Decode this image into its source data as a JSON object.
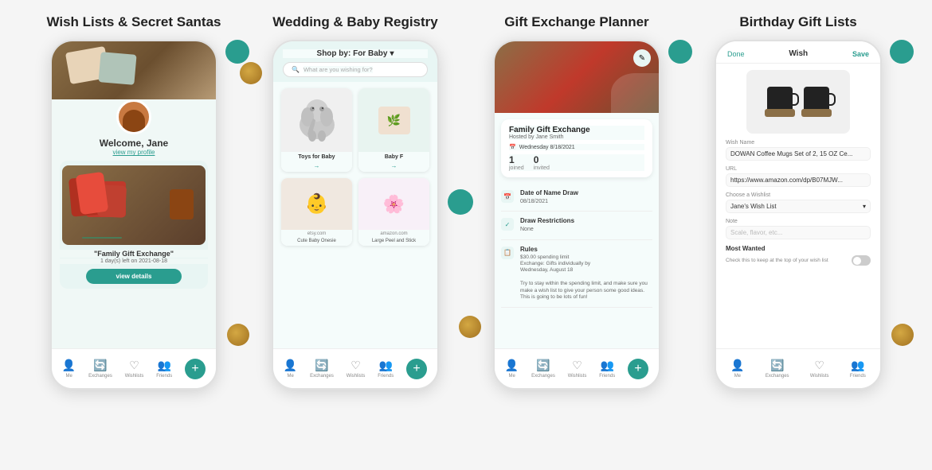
{
  "columns": [
    {
      "id": "wish-lists",
      "title": "Wish Lists & Secret Santas",
      "phone": {
        "welcome": "Welcome, Jane",
        "profile_link": "view my profile",
        "event_name": "\"Family Gift Exchange\"",
        "event_sub": "1 day(s) left on 2021-08-18",
        "view_btn": "view details",
        "nav_items": [
          "Me",
          "Exchanges",
          "Wishlists",
          "Friends"
        ]
      }
    },
    {
      "id": "wedding-registry",
      "title": "Wedding & Baby Registry",
      "phone": {
        "shop_by": "Shop by: For Baby",
        "search_placeholder": "What are you wishing for?",
        "product1_label": "Toys for Baby",
        "product2_label": "Baby F",
        "source1": "etsy.com",
        "source2": "amazon.com",
        "product1_desc": "Cute Baby Onesie",
        "product2_desc": "Large Peel and Stick",
        "nav_items": [
          "Me",
          "Exchanges",
          "Wishlists",
          "Friends"
        ]
      }
    },
    {
      "id": "gift-exchange",
      "title": "Gift Exchange Planner",
      "phone": {
        "event_title": "Family Gift Exchange",
        "host": "Hosted by Jane Smith",
        "date": "Wednesday 8/18/2021",
        "joined": "1",
        "invited": "0",
        "joined_label": "joined",
        "invited_label": "invited",
        "detail1_title": "Date of Name Draw",
        "detail1_val": "08/18/2021",
        "detail2_title": "Draw Restrictions",
        "detail2_val": "None",
        "detail3_title": "Rules",
        "detail3_val": "$30.00 spending limit\nExchange: Gifts individually by\nWednesday, August 18\n\nTry to stay within the spending limit, and make sure you make a wish list to give your person some good ideas. This is going to be lots of fun!",
        "nav_items": [
          "Me",
          "Exchanges",
          "Wishlists",
          "Friends"
        ]
      }
    },
    {
      "id": "birthday",
      "title": "Birthday Gift Lists",
      "phone": {
        "top_done": "Done",
        "top_wish": "Wish",
        "top_save": "Save",
        "wish_name_label": "Wish Name",
        "wish_name_val": "DOWAN Coffee Mugs Set of 2, 15 OZ Ce...",
        "url_label": "URL",
        "url_val": "https://www.amazon.com/dp/B07MJW...",
        "wishlist_label": "Choose a Wishlist",
        "wishlist_val": "Jane's Wish List",
        "note_label": "Note",
        "note_placeholder": "Scale, flavor, etc...",
        "most_wanted_title": "Most Wanted",
        "most_wanted_sub": "Check this to keep at the top of your wish list",
        "nav_items": [
          "Me",
          "Exchanges",
          "Wishlists",
          "Friends"
        ]
      }
    }
  ]
}
